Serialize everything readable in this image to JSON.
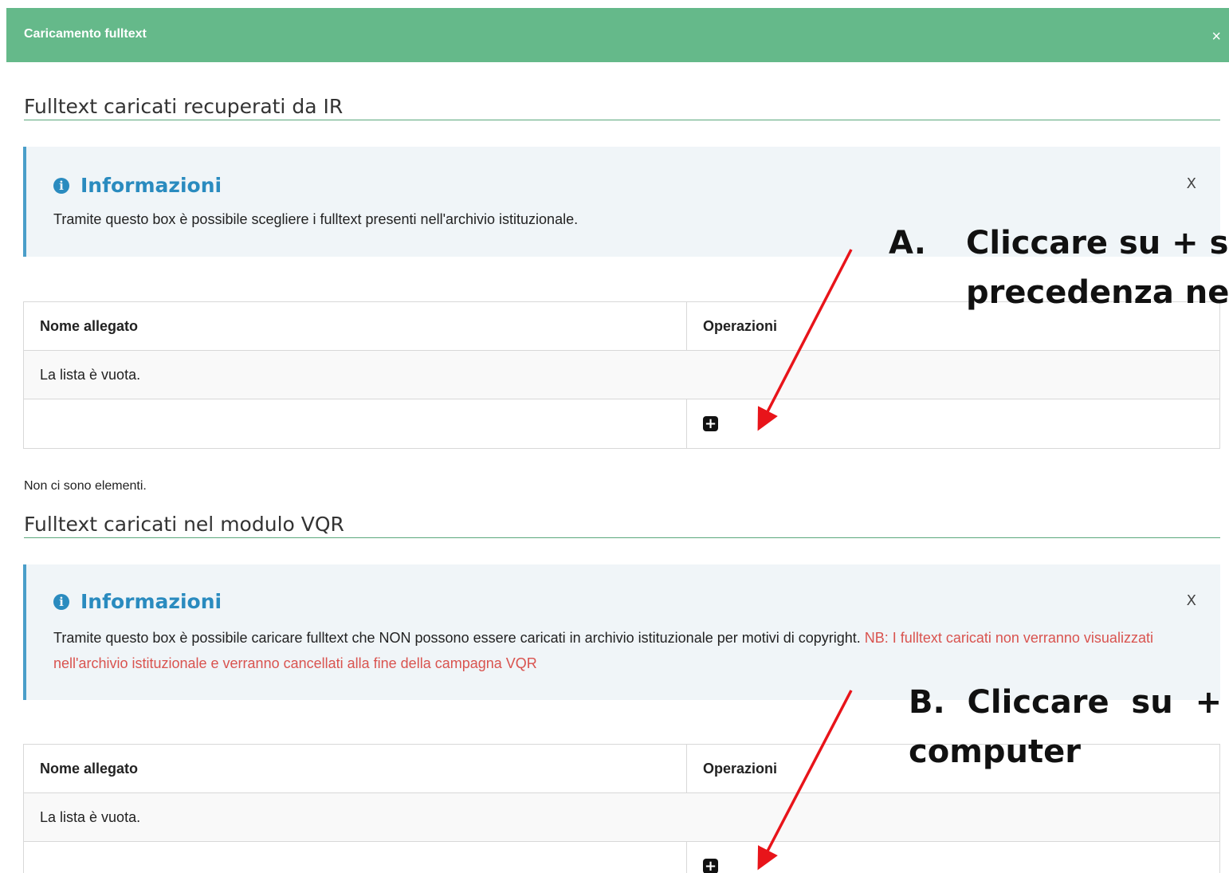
{
  "modal": {
    "title": "Caricamento fulltext",
    "close": "×"
  },
  "section_ir": {
    "title": "Fulltext caricati recuperati da IR",
    "info": {
      "heading": "Informazioni",
      "icon": "info-circle-icon",
      "close": "X",
      "text": "Tramite questo box è possibile scegliere i fulltext presenti nell'archivio istituzionale."
    },
    "table": {
      "col_name": "Nome allegato",
      "col_ops": "Operazioni",
      "empty": "La lista è vuota.",
      "add_button": "+"
    },
    "footer_note": "Non ci sono elementi."
  },
  "section_vqr": {
    "title": "Fulltext caricati nel modulo VQR",
    "info": {
      "heading": "Informazioni",
      "icon": "info-circle-icon",
      "close": "X",
      "text": "Tramite questo box è possibile caricare fulltext che NON possono essere caricati in archivio istituzionale per motivi di copyright.",
      "warning": "NB: I fulltext caricati non verranno visualizzati nell'archivio istituzionale e verranno cancellati alla fine della campagna VQR"
    },
    "table": {
      "col_name": "Nome allegato",
      "col_ops": "Operazioni",
      "empty": "La lista è vuota.",
      "add_button": "+"
    }
  },
  "annotations": {
    "a_marker": "A.",
    "a_line1": "Cliccare su + se",
    "a_line2": "precedenza nel",
    "b_line1": "B.  Cliccare  su  +",
    "b_line2": "computer"
  },
  "colors": {
    "header_bg": "#65b98a",
    "info_accent": "#2a8bbf",
    "warning": "#d9534f",
    "arrow": "#e8141a"
  }
}
